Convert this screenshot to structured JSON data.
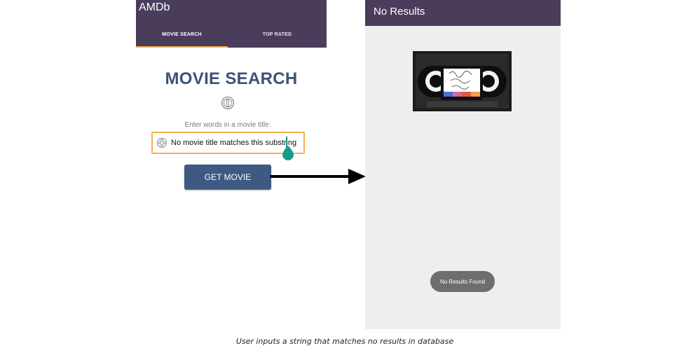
{
  "left_screen": {
    "app_title": "AMDb",
    "tabs": [
      {
        "label": "MOVIE SEARCH",
        "active": true
      },
      {
        "label": "TOP RATED",
        "active": false
      }
    ],
    "heading": "MOVIE SEARCH",
    "prompt": "Enter words in a movie title:",
    "search_input": {
      "value": "No movie title matches this substring"
    },
    "button_label": "GET MOVIE"
  },
  "right_screen": {
    "title": "No Results",
    "toast": "No Results Found"
  },
  "caption": "User inputs a string that matches no results in database",
  "colors": {
    "app_bar": "#4a3d5c",
    "accent": "#f3b04c",
    "heading": "#3d5278",
    "button": "#3f5a82",
    "cursor": "#1a9a8a"
  },
  "icons": [
    "film-reel-icon",
    "film-reel-small-icon",
    "text-cursor-handle-icon",
    "right-arrow-icon",
    "vhs-tape-logo"
  ]
}
